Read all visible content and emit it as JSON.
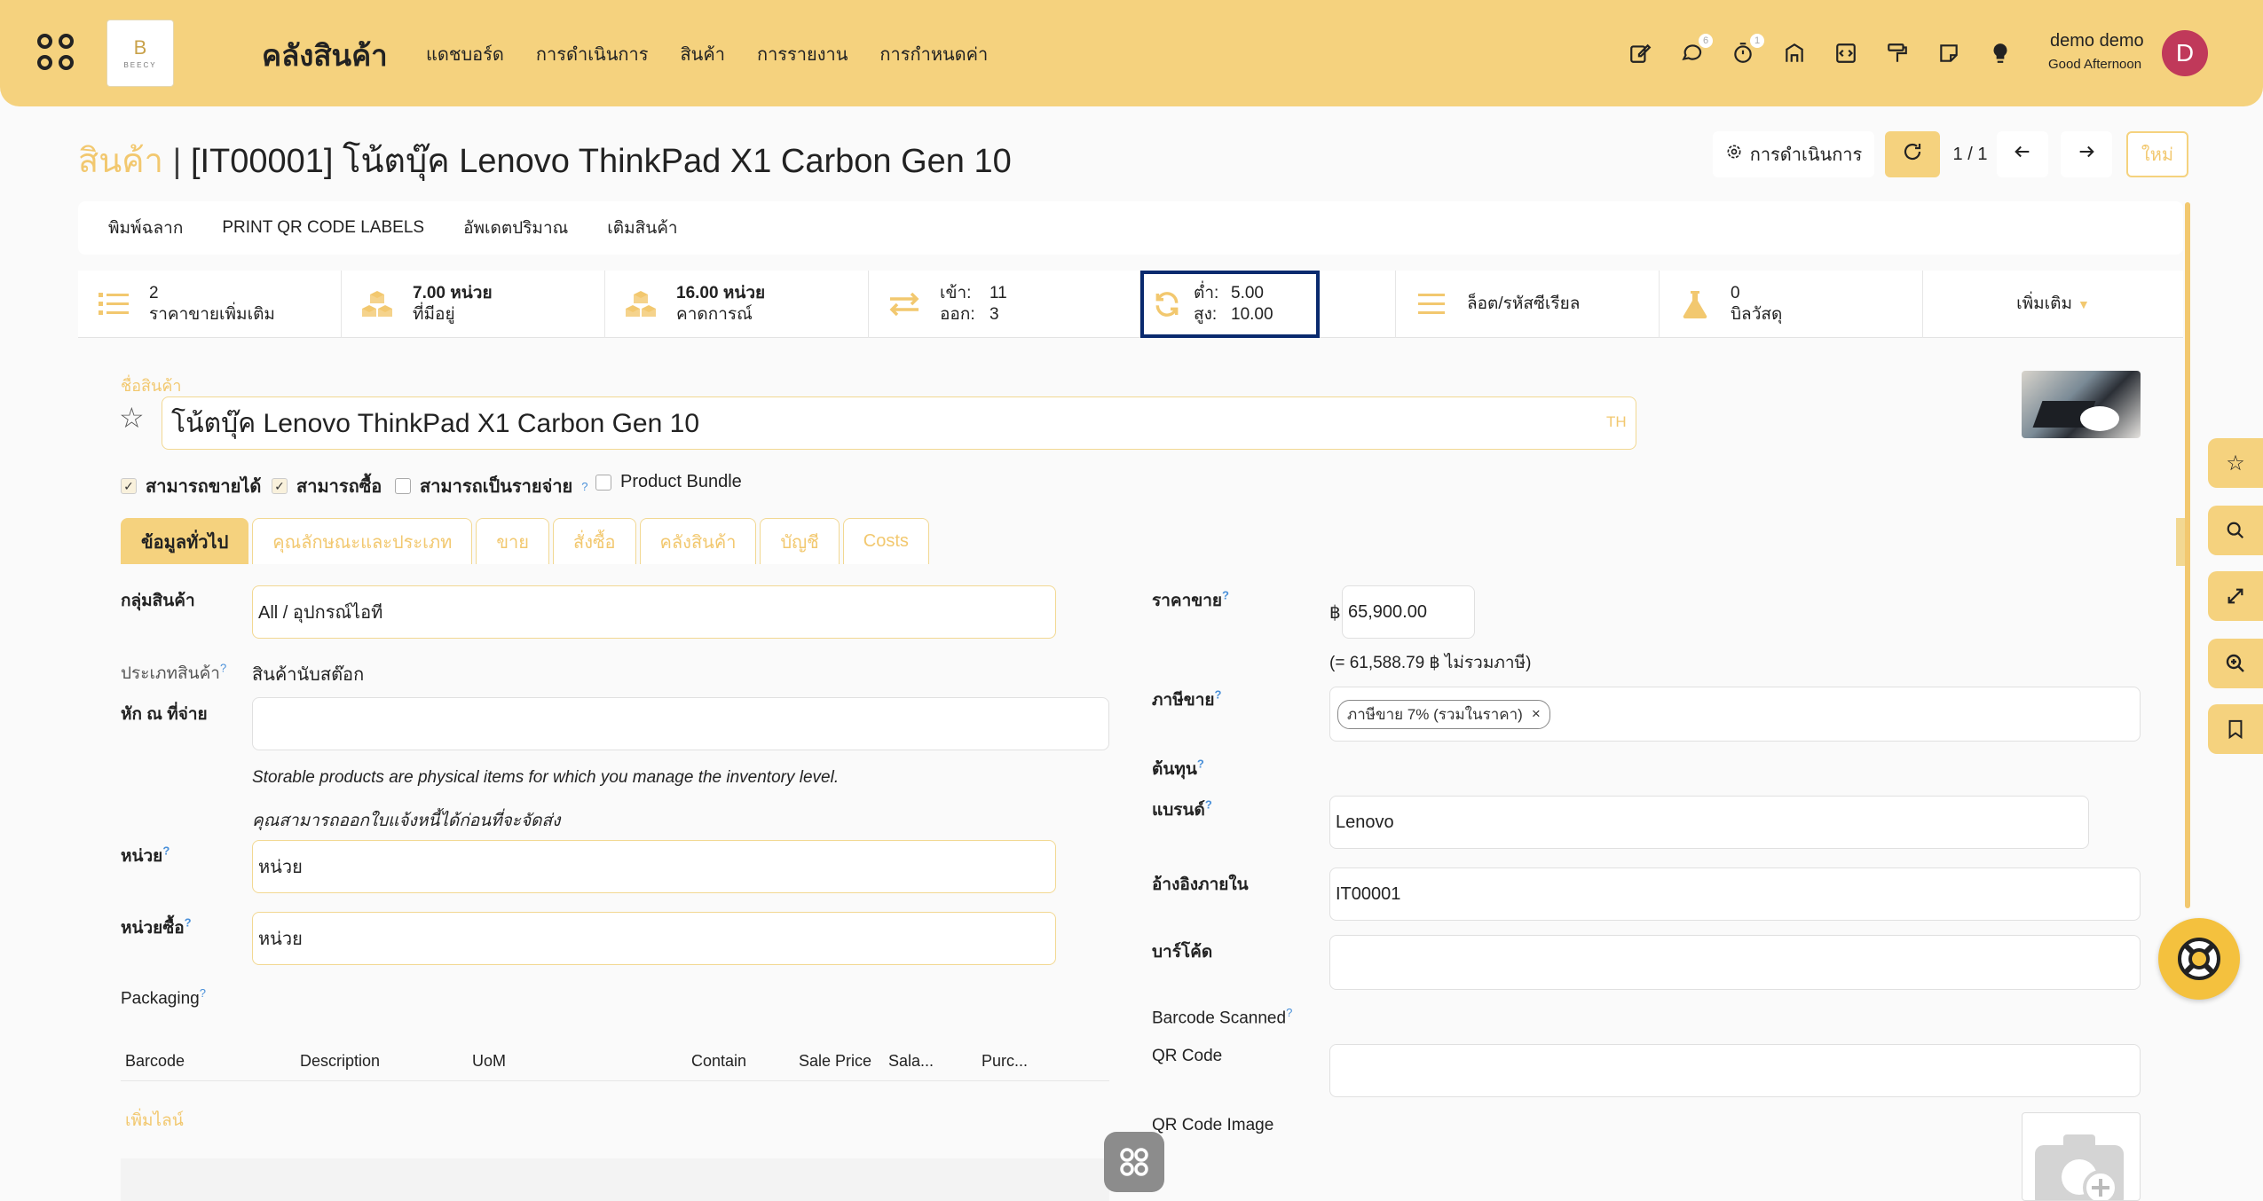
{
  "topbar": {
    "logo_letter": "B",
    "logo_text": "BEECY",
    "app_title": "คลังสินค้า",
    "menu": [
      "แดชบอร์ด",
      "การดำเนินการ",
      "สินค้า",
      "การรายงาน",
      "การกำหนดค่า"
    ],
    "icons": [
      "edit-note-icon",
      "chat-icon",
      "timer-icon",
      "building-icon",
      "code-icon",
      "paint-roller-icon",
      "sticky-note-icon",
      "lightbulb-icon"
    ],
    "chat_badge": "6",
    "timer_badge": "1",
    "user_name": "demo demo",
    "greeting": "Good Afternoon",
    "avatar_letter": "D",
    "accent_color": "#f5d27e"
  },
  "breadcrumb": {
    "parent": "สินค้า",
    "separator": "|",
    "current": "[IT00001] โน้ตบุ๊ค Lenovo ThinkPad X1 Carbon Gen 10"
  },
  "control_panel": {
    "actions_label": "การดำเนินการ",
    "pager": "1 / 1",
    "new_label": "ใหม่"
  },
  "action_buttons": [
    "พิมพ์ฉลาก",
    "PRINT QR CODE LABELS",
    "อัพเดตปริมาณ",
    "เติมสินค้า"
  ],
  "stats": {
    "extra_prices_value": "2",
    "extra_prices_label": "ราคาขายเพิ่มเติม",
    "on_hand_value": "7.00 หน่วย",
    "on_hand_label": "ที่มีอยู่",
    "forecast_value": "16.00 หน่วย",
    "forecast_label": "คาดการณ์",
    "in_label": "เข้า:",
    "in_value": "11",
    "out_label": "ออก:",
    "out_value": "3",
    "min_label": "ต่ำ:",
    "min_value": "5.00",
    "max_label": "สูง:",
    "max_value": "10.00",
    "lots_label": "ล็อต/รหัสซีเรียล",
    "bom_value": "0",
    "bom_label": "บิลวัสดุ",
    "more_label": "เพิ่มเติม"
  },
  "form": {
    "name_label": "ชื่อสินค้า",
    "name_value": "โน้ตบุ๊ค Lenovo ThinkPad X1 Carbon Gen 10",
    "lang": "TH",
    "checkboxes": [
      {
        "label": "สามารถขายได้",
        "checked": true
      },
      {
        "label": "สามารถซื้อ",
        "checked": true
      },
      {
        "label": "สามารถเป็นรายจ่าย",
        "checked": false
      },
      {
        "label": "Product Bundle",
        "checked": false
      }
    ],
    "tabs": [
      "ข้อมูลทั่วไป",
      "คุณลักษณะและประเภท",
      "ขาย",
      "สั่งซื้อ",
      "คลังสินค้า",
      "บัญชี",
      "Costs"
    ],
    "category_label": "กลุ่มสินค้า",
    "category_value": "All / อุปกรณ์ไอที",
    "type_label": "ประเภทสินค้า",
    "type_value": "สินค้านับสต๊อก",
    "wht_label": "หัก ณ ที่จ่าย",
    "wht_value": "",
    "storable_note": "Storable products are physical items for which you manage the inventory level.",
    "invoice_note": "คุณสามารถออกใบแจ้งหนี้ได้ก่อนที่จะจัดส่ง",
    "uom_label": "หน่วย",
    "uom_value": "หน่วย",
    "po_uom_label": "หน่วยซื้อ",
    "po_uom_value": "หน่วย",
    "packaging_label": "Packaging",
    "packaging_columns": [
      "Barcode",
      "Description",
      "UoM",
      "Contain",
      "Sale Price",
      "Sala...",
      "Purc..."
    ],
    "add_line": "เพิ่มไลน์",
    "sale_price_label": "ราคาขาย",
    "currency": "฿",
    "sale_price_value": "65,900.00",
    "price_excl_tax": "(= 61,588.79 ฿ ไม่รวมภาษี)",
    "tax_label": "ภาษีขาย",
    "tax_tag": "ภาษีขาย 7% (รวมในราคา)",
    "cost_label": "ต้นทุน",
    "brand_label": "แบรนด์",
    "brand_value": "Lenovo",
    "ref_label": "อ้างอิงภายใน",
    "ref_value": "IT00001",
    "barcode_label": "บาร์โค้ด",
    "barcode_value": "",
    "barcode_scanned_label": "Barcode Scanned",
    "qr_label": "QR Code",
    "qr_value": "",
    "qr_image_label": "QR Code Image"
  }
}
